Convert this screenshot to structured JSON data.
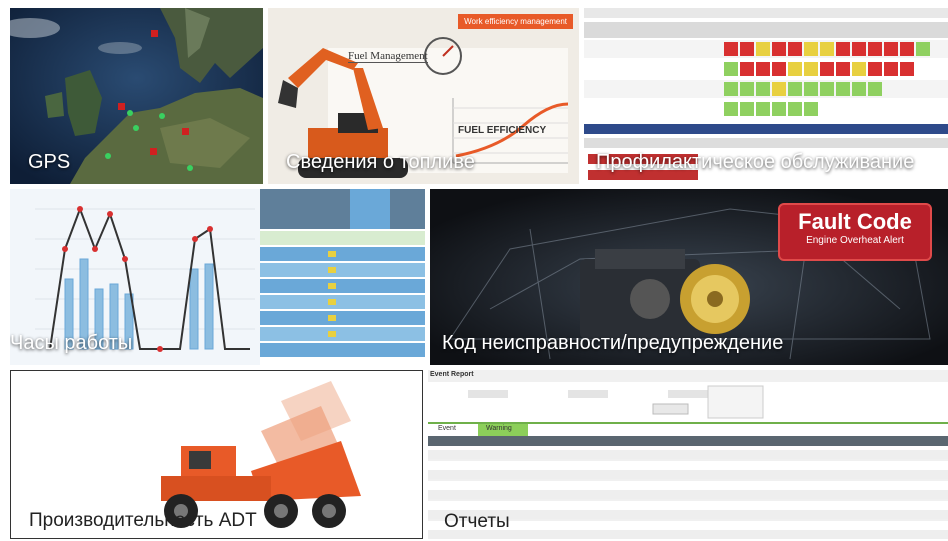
{
  "tiles": {
    "gps": {
      "caption": "GPS"
    },
    "fuel": {
      "caption": "Сведения о топливе",
      "badge": "Work efficiency management",
      "sign_title": "Fuel Management",
      "label": "FUEL EFFICIENCY"
    },
    "maintenance": {
      "caption": "Профилактическое обслуживание"
    },
    "hours": {
      "caption": "Часы работы"
    },
    "fault": {
      "caption": "Код неисправности/предупреждение",
      "banner_title": "Fault Code",
      "banner_sub": "Engine Overheat Alert"
    },
    "adt": {
      "caption": "Производительность ADT"
    },
    "reports": {
      "caption": "Отчеты",
      "title": "Event Report",
      "tab_event": "Event",
      "tab_warning": "Warning"
    }
  },
  "colors": {
    "accent_orange": "#e85a28",
    "table_blue": "#6aa8d8",
    "banner_red": "#b8202a"
  }
}
